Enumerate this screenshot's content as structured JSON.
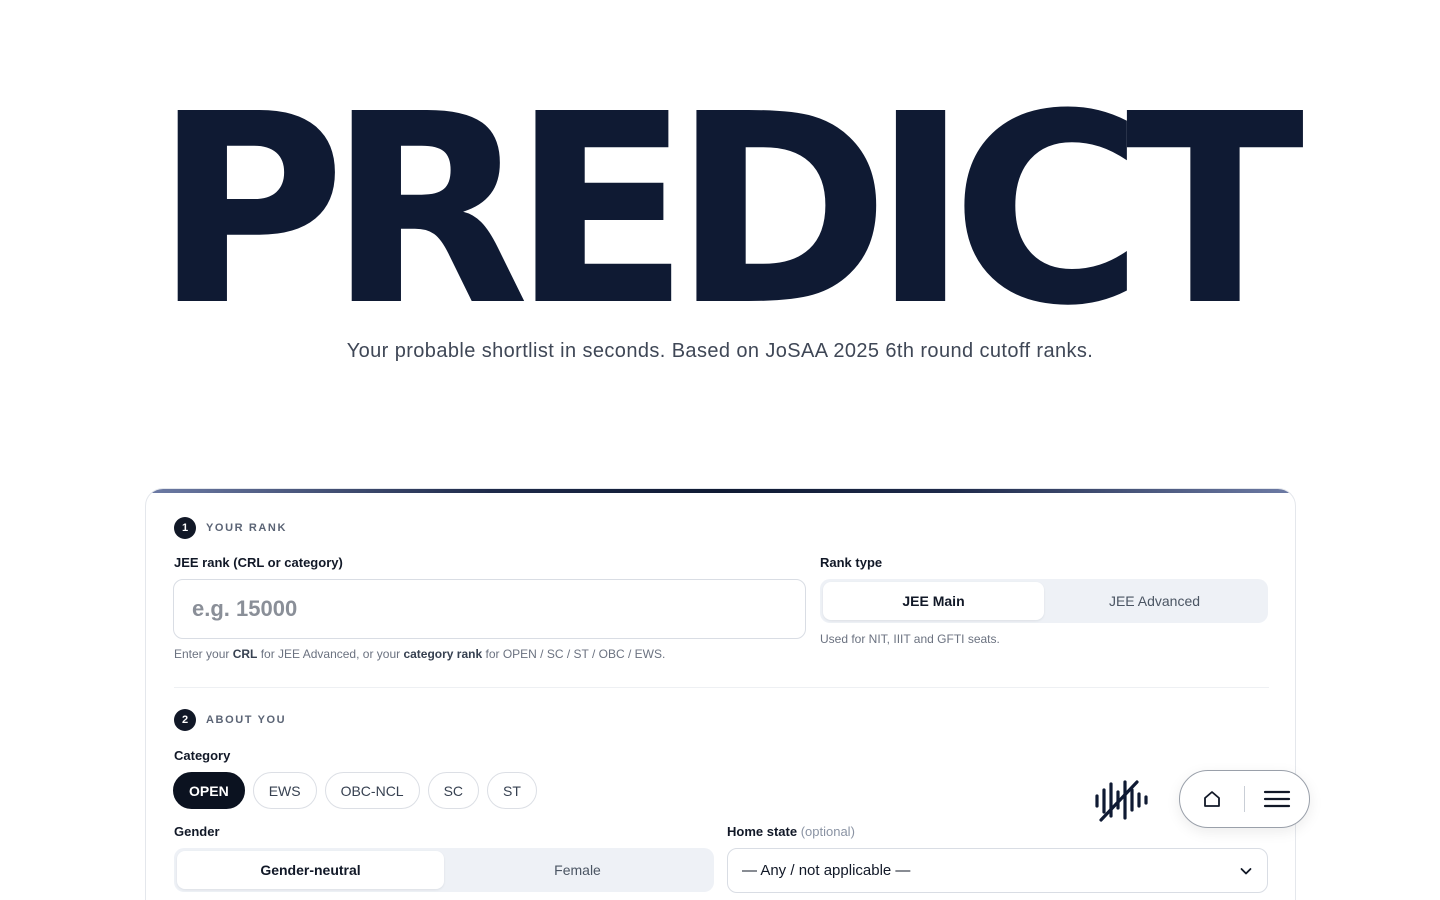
{
  "hero": {
    "title": "PREDICT",
    "subtitle": "Your probable shortlist in seconds. Based on JoSAA 2025 6th round cutoff ranks."
  },
  "form": {
    "step1": {
      "number": "1",
      "label": "YOUR RANK"
    },
    "rank_field": {
      "label": "JEE rank (CRL or category)",
      "placeholder": "e.g. 15000",
      "value": "",
      "help_prefix": "Enter your ",
      "help_bold1": "CRL",
      "help_mid": " for JEE Advanced, or your ",
      "help_bold2": "category rank",
      "help_suffix": " for OPEN / SC / ST / OBC / EWS."
    },
    "rank_type": {
      "label": "Rank type",
      "options": [
        "JEE Main",
        "JEE Advanced"
      ],
      "selected": "JEE Main",
      "help": "Used for NIT, IIIT and GFTI seats."
    },
    "step2": {
      "number": "2",
      "label": "ABOUT YOU"
    },
    "category": {
      "label": "Category",
      "options": [
        "OPEN",
        "EWS",
        "OBC-NCL",
        "SC",
        "ST"
      ],
      "selected": "OPEN"
    },
    "gender": {
      "label": "Gender",
      "options": [
        "Gender-neutral",
        "Female"
      ],
      "selected": "Gender-neutral"
    },
    "home_state": {
      "label": "Home state",
      "optional": "(optional)",
      "value": "— Any / not applicable —"
    }
  },
  "floating": {
    "voice_icon": "audio-wave-muted-icon",
    "home_icon": "home-icon",
    "menu_icon": "hamburger-menu-icon"
  },
  "colors": {
    "ink": "#0f1a33",
    "chip_active": "#0b1220",
    "segment_bg": "#eef1f6"
  }
}
